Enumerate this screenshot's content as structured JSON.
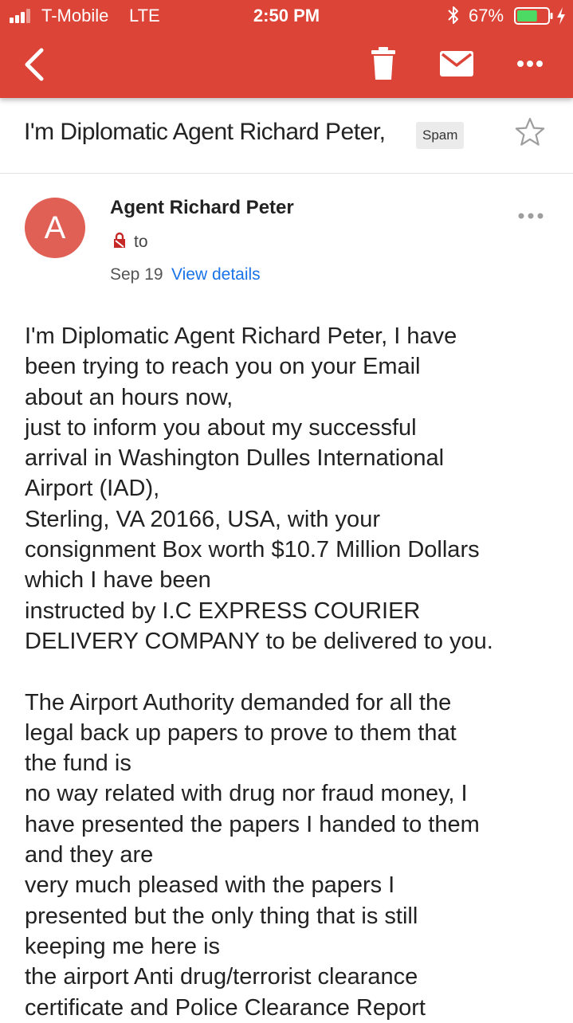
{
  "status_bar": {
    "carrier": "T-Mobile",
    "network": "LTE",
    "time": "2:50 PM",
    "battery_percent": "67%",
    "battery_level": 0.67
  },
  "toolbar": {
    "back_icon": "chevron-left-icon",
    "trash_icon": "trash-icon",
    "mail_icon": "mail-icon",
    "more_icon": "more-horizontal-icon"
  },
  "email": {
    "subject": "I'm Diplomatic Agent Richard Peter,",
    "label": "Spam",
    "avatar_letter": "A",
    "sender": "Agent Richard Peter",
    "to_label": "to",
    "date": "Sep 19",
    "view_details": "View details",
    "body_lines": [
      "I'm Diplomatic Agent Richard Peter, I have",
      "been trying to reach you on your Email",
      "about an hours now,",
      "just to inform you about my successful",
      "arrival in Washington Dulles International",
      "Airport (IAD),",
      "Sterling, VA 20166, USA, with your",
      "consignment Box worth $10.7 Million Dollars",
      "which I have been",
      "instructed by I.C EXPRESS COURIER",
      "DELIVERY COMPANY to be delivered to you.",
      "",
      "The Airport Authority demanded for all the",
      "legal back up papers to prove to them that",
      "the fund is",
      "no way related with drug nor fraud money, I",
      "have presented the papers I handed to them",
      "and they are",
      "very much pleased with the papers I",
      "presented but the only thing that is still",
      "keeping me here is",
      "the airport Anti drug/terrorist clearance",
      "certificate and Police Clearance Report"
    ]
  },
  "colors": {
    "accent": "#db4437",
    "avatar": "#e06055",
    "link": "#1a73e8",
    "battery_fill": "#4cd964"
  }
}
